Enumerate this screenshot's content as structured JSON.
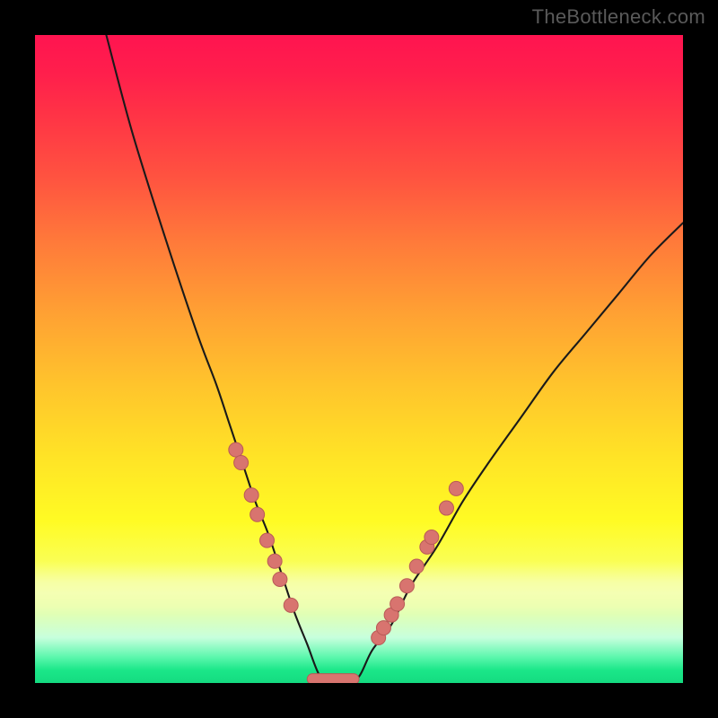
{
  "watermark": "TheBottleneck.com",
  "colors": {
    "frame_bg": "#000000",
    "curve": "#1a1a1a",
    "dot_fill": "#d8746f",
    "dot_stroke": "#b95a57"
  },
  "chart_data": {
    "type": "line",
    "title": "",
    "xlabel": "",
    "ylabel": "",
    "xlim": [
      0,
      100
    ],
    "ylim": [
      0,
      100
    ],
    "grid": false,
    "legend": false,
    "note": "Values are estimates read from an unlabeled bottleneck chart; y is bottleneck %, x is relative component performance. Curve minimum (0% bottleneck) is a plateau around x≈44–49.",
    "series": [
      {
        "name": "bottleneck-curve",
        "x": [
          11,
          15,
          20,
          25,
          28,
          30,
          32,
          34,
          36,
          38,
          40,
          42,
          44,
          46,
          48,
          50,
          52,
          55,
          58,
          62,
          66,
          70,
          75,
          80,
          85,
          90,
          95,
          100
        ],
        "y": [
          100,
          85,
          69,
          54,
          46,
          40,
          34,
          28,
          23,
          17,
          11,
          6,
          1,
          0,
          0,
          1,
          5,
          9,
          15,
          21,
          28,
          34,
          41,
          48,
          54,
          60,
          66,
          71
        ]
      }
    ],
    "dots_left": [
      {
        "x": 31.0,
        "y": 36.0
      },
      {
        "x": 31.8,
        "y": 34.0
      },
      {
        "x": 33.4,
        "y": 29.0
      },
      {
        "x": 34.3,
        "y": 26.0
      },
      {
        "x": 35.8,
        "y": 22.0
      },
      {
        "x": 37.0,
        "y": 18.8
      },
      {
        "x": 37.8,
        "y": 16.0
      },
      {
        "x": 39.5,
        "y": 12.0
      }
    ],
    "dots_right": [
      {
        "x": 53.0,
        "y": 7.0
      },
      {
        "x": 53.8,
        "y": 8.5
      },
      {
        "x": 55.0,
        "y": 10.5
      },
      {
        "x": 55.9,
        "y": 12.2
      },
      {
        "x": 57.4,
        "y": 15.0
      },
      {
        "x": 58.9,
        "y": 18.0
      },
      {
        "x": 60.5,
        "y": 21.0
      },
      {
        "x": 61.2,
        "y": 22.5
      },
      {
        "x": 63.5,
        "y": 27.0
      },
      {
        "x": 65.0,
        "y": 30.0
      }
    ],
    "plateau_bar": {
      "x0": 42.0,
      "x1": 50.0,
      "y": 0.6
    }
  }
}
